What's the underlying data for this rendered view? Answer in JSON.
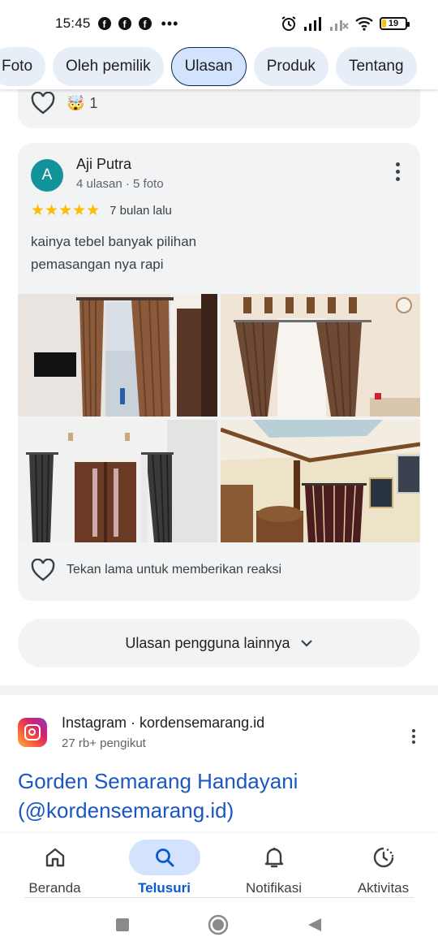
{
  "status_bar": {
    "time": "15:45",
    "notification_icons": [
      "facebook-icon",
      "facebook-icon",
      "facebook-icon"
    ],
    "more": "•••",
    "battery": "19",
    "battery_level": 0.19
  },
  "tabs": [
    {
      "label": "Foto",
      "active": false
    },
    {
      "label": "Oleh pemilik",
      "active": false
    },
    {
      "label": "Ulasan",
      "active": true
    },
    {
      "label": "Produk",
      "active": false
    },
    {
      "label": "Tentang",
      "active": false
    }
  ],
  "previous_review": {
    "reaction_emoji": "🤯",
    "reaction_count": "1"
  },
  "review": {
    "avatar_letter": "A",
    "avatar_color": "#12939a",
    "name": "Aji Putra",
    "meta": "4 ulasan · 5 foto",
    "rating": 5,
    "stars": "★★★★★",
    "time_ago": "7 bulan lalu",
    "text_line1": "kainya tebel banyak pilihan",
    "text_line2": "pemasangan nya rapi",
    "photo_count": 4,
    "reaction_hint": "Tekan lama untuk memberikan reaksi"
  },
  "more_reviews_button": "Ulasan pengguna lainnya",
  "result": {
    "source": "Instagram · kordensemarang.id",
    "followers": "27 rb+ pengikut",
    "title_line1": "Gorden Semarang Handayani",
    "title_line2": "(@kordensemarang.id)"
  },
  "bottom_nav": [
    {
      "label": "Beranda",
      "icon": "home-icon",
      "active": false
    },
    {
      "label": "Telusuri",
      "icon": "search-icon",
      "active": true
    },
    {
      "label": "Notifikasi",
      "icon": "bell-icon",
      "active": false
    },
    {
      "label": "Aktivitas",
      "icon": "activity-icon",
      "active": false
    }
  ],
  "colors": {
    "accent": "#0b57d0",
    "link": "#1a57c2",
    "star": "#fbbc04",
    "chip": "#e8eef8",
    "chip_active": "#d3e3fd"
  }
}
